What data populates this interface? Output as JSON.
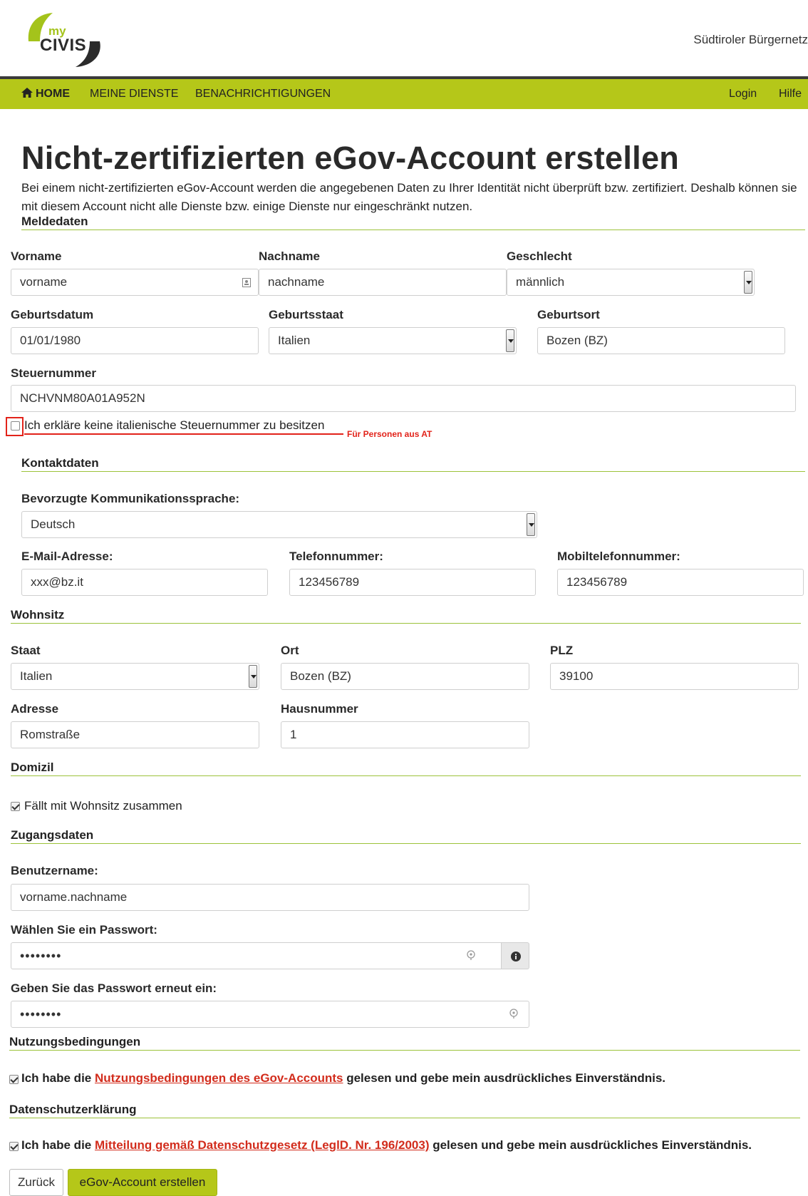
{
  "header": {
    "logo_my": "my",
    "logo_civis": "CIVIS",
    "site_name": "Südtiroler Bürgernetz"
  },
  "nav": {
    "home": "HOME",
    "services": "MEINE DIENSTE",
    "notifications": "BENACHRICHTIGUNGEN",
    "login": "Login",
    "help": "Hilfe"
  },
  "page": {
    "title": "Nicht-zertifizierten eGov-Account erstellen",
    "intro": "Bei einem nicht-zertifizierten eGov-Account werden die angegebenen Daten zu Ihrer Identität nicht überprüft bzw. zertifiziert. Deshalb können sie mit diesem Account nicht alle Dienste bzw. einige Dienste nur eingeschränkt nutzen."
  },
  "meldedaten": {
    "heading": "Meldedaten",
    "vorname_label": "Vorname",
    "vorname_value": "vorname",
    "nachname_label": "Nachname",
    "nachname_value": "nachname",
    "geschlecht_label": "Geschlecht",
    "geschlecht_value": "männlich",
    "geburtsdatum_label": "Geburtsdatum",
    "geburtsdatum_value": "01/01/1980",
    "geburtsstaat_label": "Geburtsstaat",
    "geburtsstaat_value": "Italien",
    "geburtsort_label": "Geburtsort",
    "geburtsort_value": "Bozen (BZ)",
    "steuernummer_label": "Steuernummer",
    "steuernummer_value": "NCHVNM80A01A952N",
    "no_tax_checkbox_label": "Ich erkläre keine italienische Steuernummer zu besitzen",
    "annotation": "Für Personen aus AT"
  },
  "kontakt": {
    "heading": "Kontaktdaten",
    "sprache_label": "Bevorzugte Kommunikationssprache:",
    "sprache_value": "Deutsch",
    "email_label": "E-Mail-Adresse:",
    "email_value": "xxx@bz.it",
    "telefon_label": "Telefonnummer:",
    "telefon_value": "123456789",
    "mobil_label": "Mobiltelefonnummer:",
    "mobil_value": "123456789"
  },
  "wohnsitz": {
    "heading": "Wohnsitz",
    "staat_label": "Staat",
    "staat_value": "Italien",
    "ort_label": "Ort",
    "ort_value": "Bozen (BZ)",
    "plz_label": "PLZ",
    "plz_value": "39100",
    "adresse_label": "Adresse",
    "adresse_value": "Romstraße",
    "hausnummer_label": "Hausnummer",
    "hausnummer_value": "1"
  },
  "domizil": {
    "heading": "Domizil",
    "same_label": "Fällt mit Wohnsitz zusammen",
    "same_checked": true
  },
  "zugang": {
    "heading": "Zugangsdaten",
    "benutzer_label": "Benutzername:",
    "benutzer_value": "vorname.nachname",
    "passwort_label": "Wählen Sie ein Passwort:",
    "passwort_value": "••••••••",
    "passwort2_label": "Geben Sie das Passwort erneut ein:",
    "passwort2_value": "••••••••"
  },
  "nutzung": {
    "heading": "Nutzungsbedingungen",
    "text_before": "Ich habe die ",
    "link": "Nutzungsbedingungen des eGov-Accounts",
    "text_after": " gelesen und gebe mein ausdrückliches Einverständnis."
  },
  "datenschutz": {
    "heading": "Datenschutzerklärung",
    "text_before": "Ich habe die ",
    "link": "Mitteilung gemäß Datenschutzgesetz (LeglD. Nr. 196/2003)",
    "text_after": " gelesen und gebe mein ausdrückliches Einverständnis."
  },
  "actions": {
    "back": "Zurück",
    "create": "eGov-Account erstellen"
  },
  "colors": {
    "accent_green": "#b5c719",
    "nav_border": "#3a3a3a",
    "link_red": "#d22c1c",
    "annotation_red": "#e2231a",
    "rule_green": "#9cc23a"
  }
}
